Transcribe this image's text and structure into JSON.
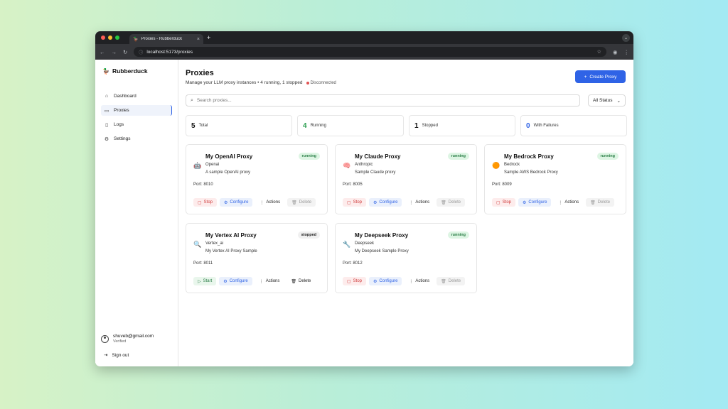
{
  "browser": {
    "tab_title": "Proxies - Rubberduck",
    "tab_close": "×",
    "new_tab": "+",
    "url": "localhost:5173/proxies",
    "lights": [
      "#ff5f57",
      "#febc2e",
      "#28c840"
    ]
  },
  "sidebar": {
    "brand": "Rubberduck",
    "items": [
      {
        "label": "Dashboard",
        "icon": "home-icon",
        "glyph": "⌂"
      },
      {
        "label": "Proxies",
        "icon": "server-icon",
        "glyph": "▭"
      },
      {
        "label": "Logs",
        "icon": "file-icon",
        "glyph": "▯"
      },
      {
        "label": "Settings",
        "icon": "gear-icon",
        "glyph": "⚙"
      }
    ],
    "user": {
      "email": "shuveb@gmail.com",
      "status": "Verified"
    },
    "signout": "Sign out"
  },
  "header": {
    "title": "Proxies",
    "subtitle": "Manage your LLM proxy instances • 4 running, 1 stopped",
    "connection": "Disconnected",
    "create_button": "Create Proxy"
  },
  "search": {
    "placeholder": "Search proxies...",
    "filter": "All Status"
  },
  "stats": [
    {
      "value": "5",
      "label": "Total",
      "color": "#111111"
    },
    {
      "value": "4",
      "label": "Running",
      "color": "#2a9d4f"
    },
    {
      "value": "1",
      "label": "Stopped",
      "color": "#111111"
    },
    {
      "value": "0",
      "label": "With Failures",
      "color": "#2f63e6"
    }
  ],
  "proxies": [
    {
      "name": "My OpenAI Proxy",
      "provider": "Openai",
      "description": "A sample OpenAI proxy",
      "port": "Port: 8010",
      "status": "running",
      "icon": "robot-icon",
      "glyph": "🤖",
      "primary": "Stop"
    },
    {
      "name": "My Claude Proxy",
      "provider": "Anthropic",
      "description": "Sample Claude proxy",
      "port": "Port: 8005",
      "status": "running",
      "icon": "brain-icon",
      "glyph": "🧠",
      "primary": "Stop"
    },
    {
      "name": "My Bedrock Proxy",
      "provider": "Bedrock",
      "description": "Sample AWS Bedrock Proxy",
      "port": "Port: 8009",
      "status": "running",
      "icon": "orange-circle-icon",
      "glyph": "🟠",
      "primary": "Stop"
    },
    {
      "name": "My Vertex AI Proxy",
      "provider": "Vertex_ai",
      "description": "My Vertex AI Proxy Sample",
      "port": "Port: 8011",
      "status": "stopped",
      "icon": "magnifier-icon",
      "glyph": "🔍",
      "primary": "Start"
    },
    {
      "name": "My Deepseek Proxy",
      "provider": "Deepseek",
      "description": "My Deepseek Sample Proxy",
      "port": "Port: 8012",
      "status": "running",
      "icon": "wrench-icon",
      "glyph": "🔧",
      "primary": "Stop"
    }
  ],
  "card_actions": {
    "configure": "Configure",
    "actions": "Actions",
    "delete": "Delete"
  }
}
